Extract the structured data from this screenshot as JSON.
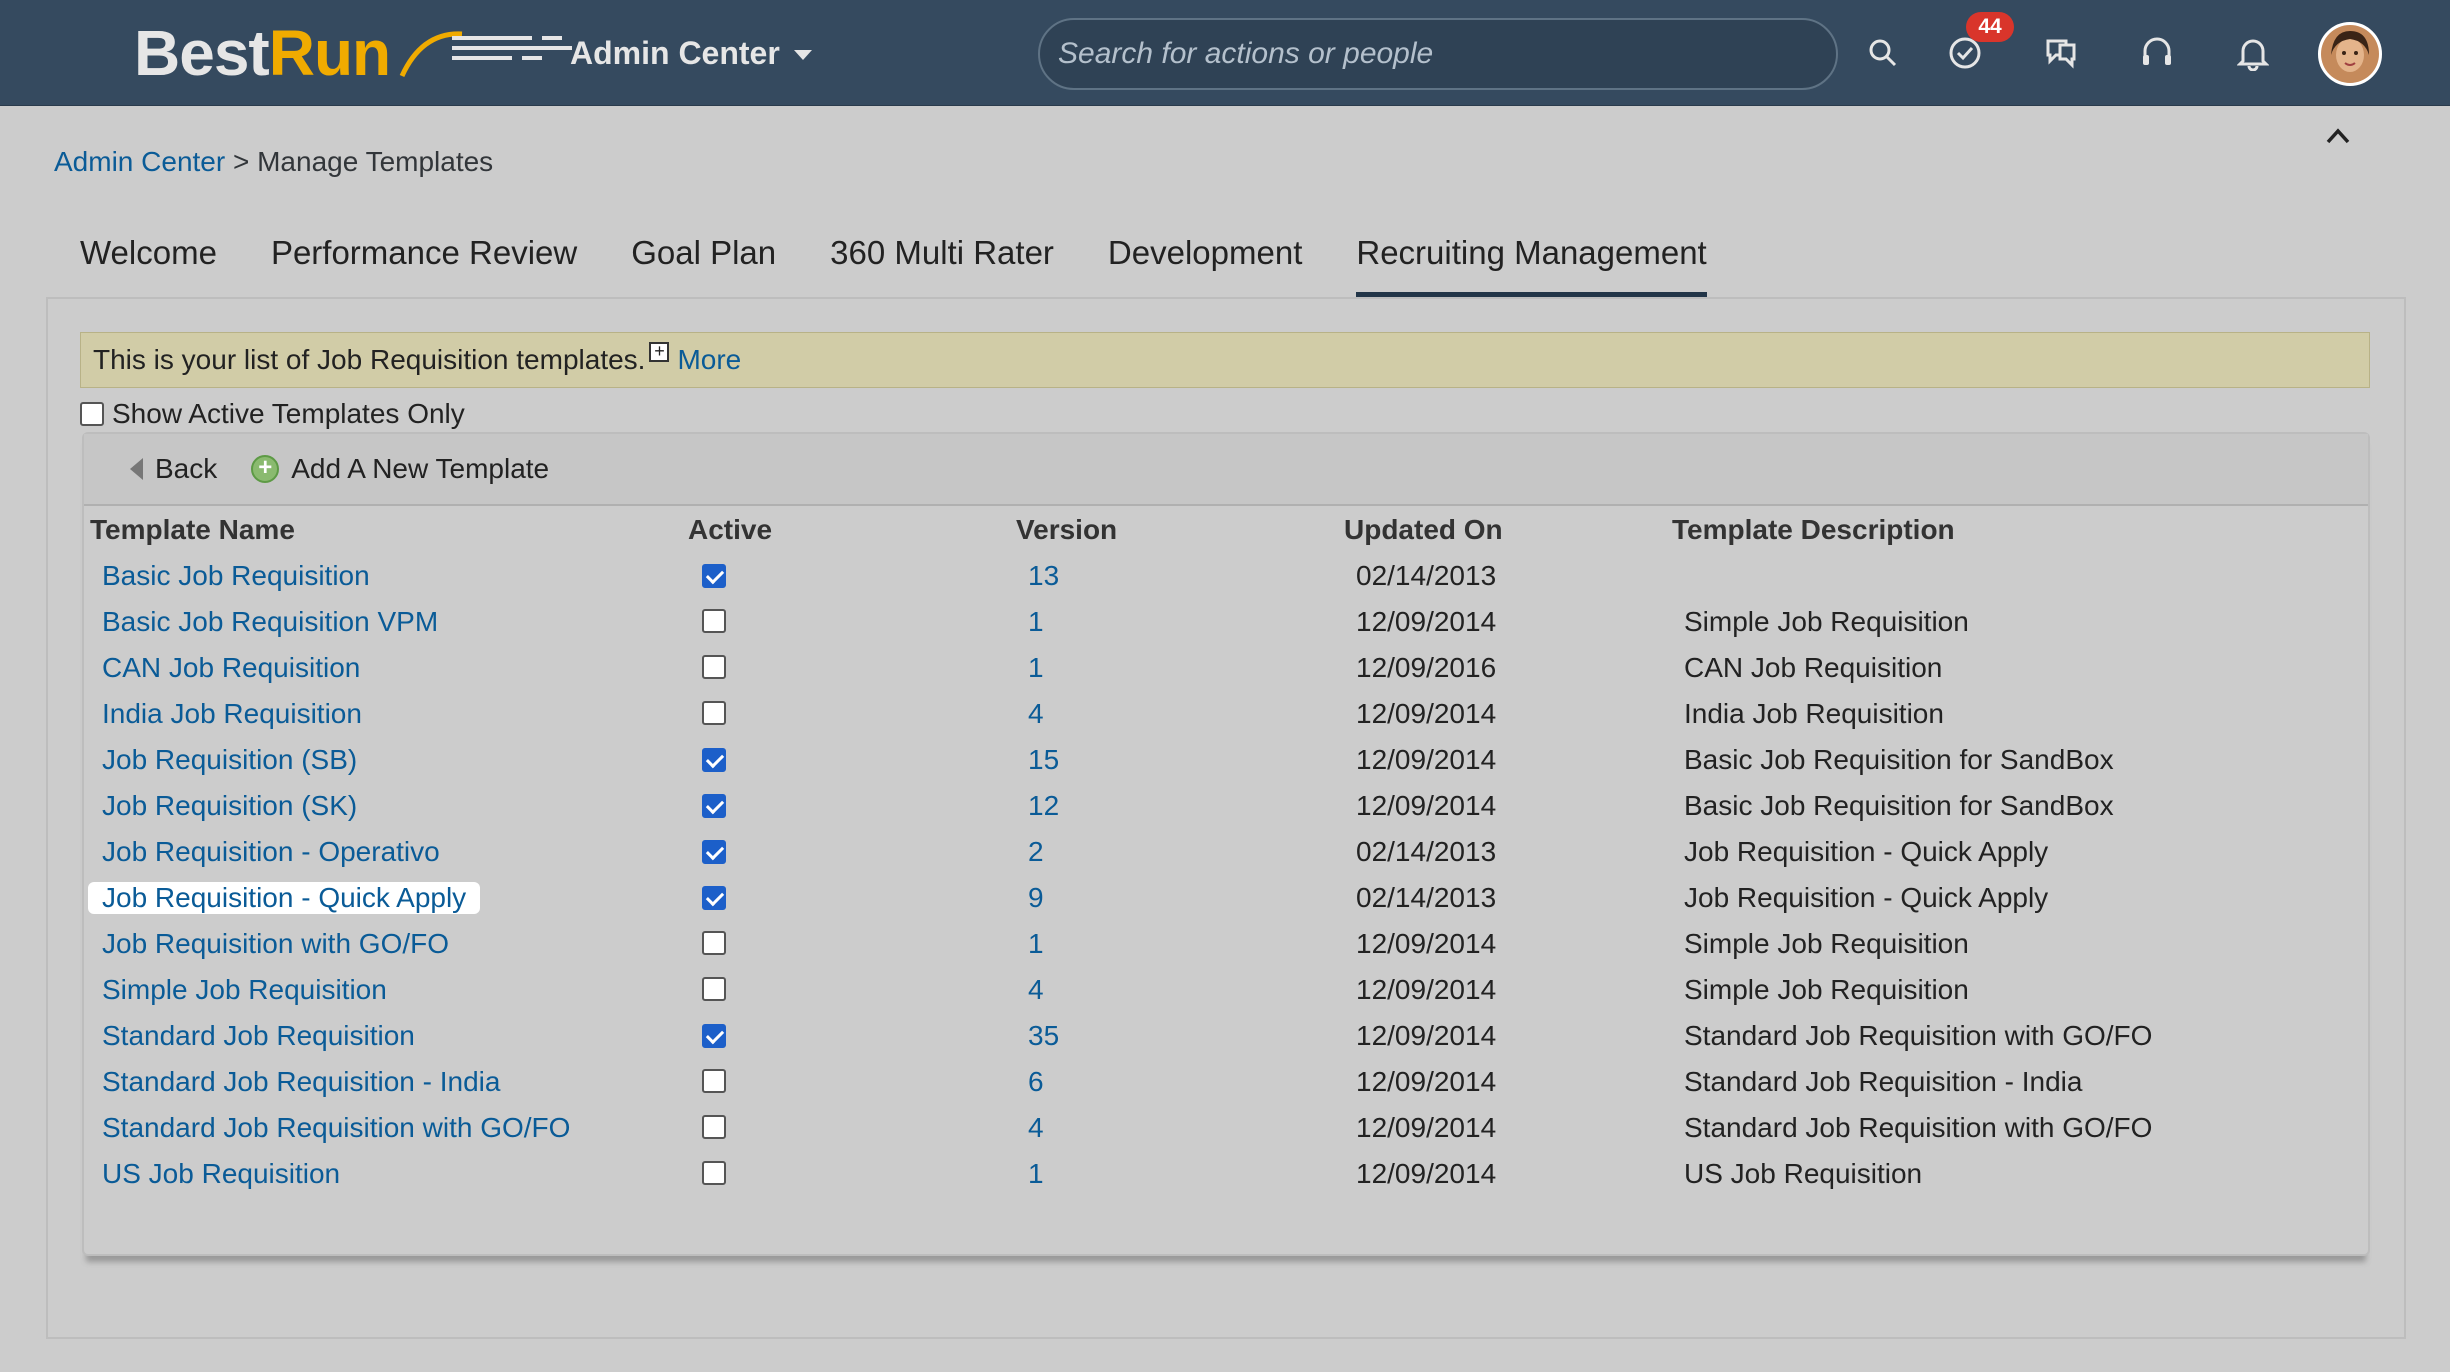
{
  "header": {
    "logo_best": "Best",
    "logo_run": "Run",
    "app_menu": "Admin Center",
    "search_placeholder": "Search for actions or people",
    "todo_badge": "44"
  },
  "breadcrumb": {
    "root": "Admin Center",
    "separator": " > ",
    "current": "Manage Templates"
  },
  "tabs": [
    {
      "label": "Welcome"
    },
    {
      "label": "Performance Review"
    },
    {
      "label": "Goal Plan"
    },
    {
      "label": "360 Multi Rater"
    },
    {
      "label": "Development"
    },
    {
      "label": "Recruiting Management"
    }
  ],
  "info": {
    "text": "This is your list of Job Requisition templates.",
    "expand_icon": "+",
    "more": "More"
  },
  "filter": {
    "show_active_label": "Show Active Templates Only"
  },
  "toolbar": {
    "back": "Back",
    "add_plus": "+",
    "add": "Add A New Template"
  },
  "columns": {
    "name": "Template Name",
    "active": "Active",
    "version": "Version",
    "updated": "Updated On",
    "description": "Template Description"
  },
  "rows": [
    {
      "name": "Basic Job Requisition",
      "active": true,
      "version": "13",
      "updated": "02/14/2013",
      "description": ""
    },
    {
      "name": "Basic Job Requisition VPM",
      "active": false,
      "version": "1",
      "updated": "12/09/2014",
      "description": "Simple Job Requisition"
    },
    {
      "name": "CAN Job Requisition",
      "active": false,
      "version": "1",
      "updated": "12/09/2016",
      "description": "CAN Job Requisition"
    },
    {
      "name": "India Job Requisition",
      "active": false,
      "version": "4",
      "updated": "12/09/2014",
      "description": "India Job Requisition"
    },
    {
      "name": "Job Requisition (SB)",
      "active": true,
      "version": "15",
      "updated": "12/09/2014",
      "description": "Basic Job Requisition for SandBox"
    },
    {
      "name": "Job Requisition (SK)",
      "active": true,
      "version": "12",
      "updated": "12/09/2014",
      "description": "Basic Job Requisition for SandBox"
    },
    {
      "name": "Job Requisition - Operativo",
      "active": true,
      "version": "2",
      "updated": "02/14/2013",
      "description": "Job Requisition - Quick Apply"
    },
    {
      "name": "Job Requisition - Quick Apply",
      "active": true,
      "version": "9",
      "updated": "02/14/2013",
      "description": "Job Requisition - Quick Apply"
    },
    {
      "name": "Job Requisition with GO/FO",
      "active": false,
      "version": "1",
      "updated": "12/09/2014",
      "description": "Simple Job Requisition"
    },
    {
      "name": "Simple Job Requisition",
      "active": false,
      "version": "4",
      "updated": "12/09/2014",
      "description": "Simple Job Requisition"
    },
    {
      "name": "Standard Job Requisition",
      "active": true,
      "version": "35",
      "updated": "12/09/2014",
      "description": "Standard Job Requisition with GO/FO"
    },
    {
      "name": "Standard Job Requisition - India",
      "active": false,
      "version": "6",
      "updated": "12/09/2014",
      "description": "Standard Job Requisition - India"
    },
    {
      "name": "Standard Job Requisition with GO/FO",
      "active": false,
      "version": "4",
      "updated": "12/09/2014",
      "description": "Standard Job Requisition with GO/FO"
    },
    {
      "name": "US Job Requisition",
      "active": false,
      "version": "1",
      "updated": "12/09/2014",
      "description": "US Job Requisition"
    }
  ],
  "colors": {
    "header_bg": "#354a5f",
    "link": "#0a5b97",
    "checkbox_checked": "#1c5fc9",
    "info_bg": "#d1cca7",
    "badge": "#d9352b"
  }
}
